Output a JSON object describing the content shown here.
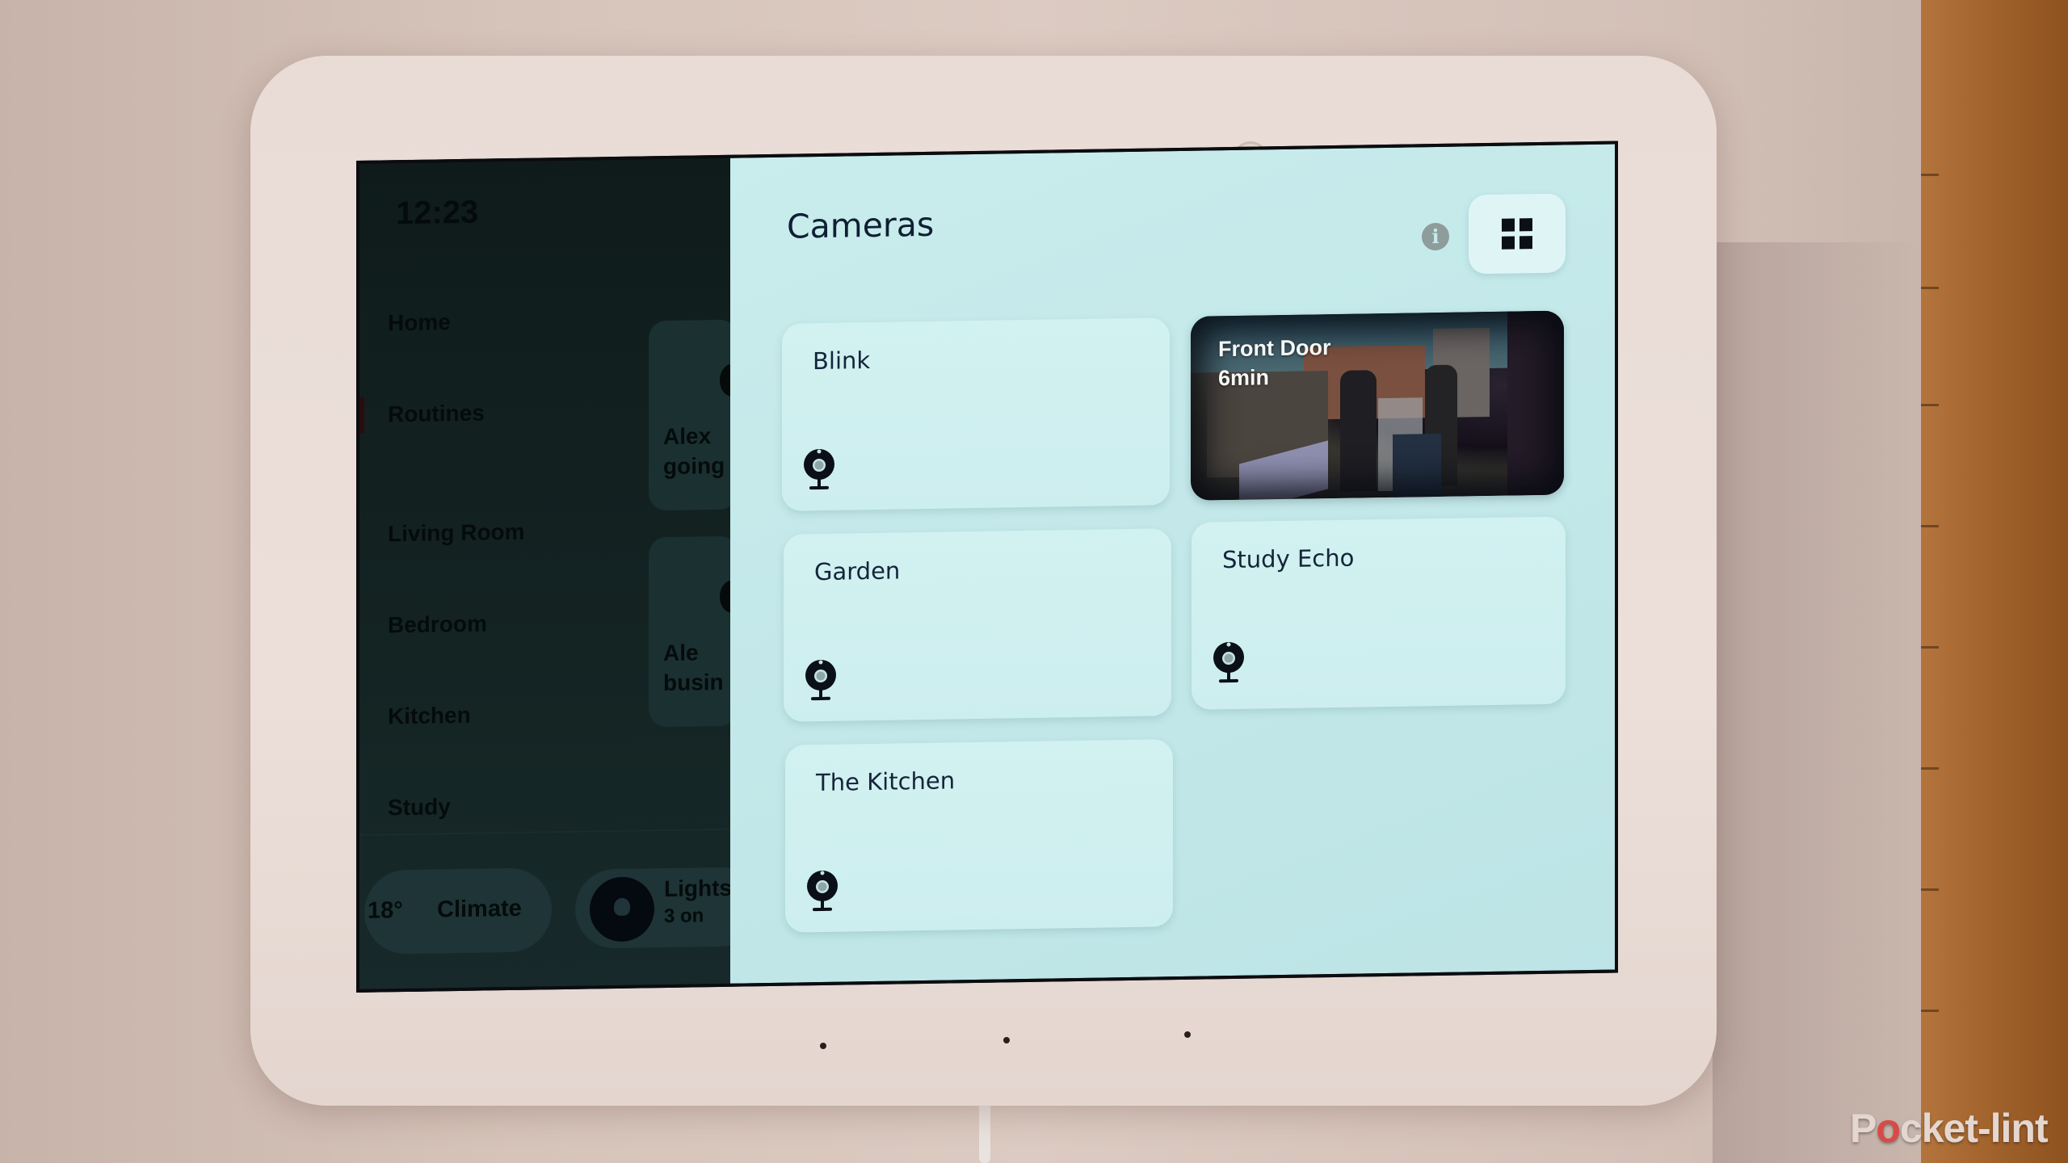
{
  "device": {
    "sidebar": {
      "clock": "12:23",
      "nav_items": [
        {
          "label": "Home"
        },
        {
          "label": "Routines",
          "active": true
        },
        {
          "label": "Living Room"
        },
        {
          "label": "Bedroom"
        },
        {
          "label": "Kitchen"
        },
        {
          "label": "Study"
        }
      ],
      "routine_cards": [
        {
          "line1": "Alex",
          "line2": "going"
        },
        {
          "line1": "Ale",
          "line2": "busin"
        }
      ],
      "climate": {
        "temperature": "18°",
        "label": "Climate"
      },
      "lights": {
        "label": "Lights",
        "status": "3 on"
      }
    },
    "cameras_panel": {
      "title": "Cameras",
      "info_icon": "info-icon",
      "view_toggle_icon": "grid-icon",
      "cameras": [
        {
          "name": "Blink",
          "icon": "webcam-icon"
        },
        {
          "name": "Front Door",
          "live_feed": true,
          "last_updated": "6min"
        },
        {
          "name": "Garden",
          "icon": "webcam-icon"
        },
        {
          "name": "Study Echo",
          "icon": "webcam-icon"
        },
        {
          "name": "The Kitchen",
          "icon": "webcam-icon"
        }
      ]
    }
  },
  "watermark": {
    "prefix": "P",
    "o": "o",
    "suffix": "cket-lint"
  },
  "colors": {
    "panel_bg": "#c6eaea",
    "card_bg": "#d0f0f0",
    "sidebar_bg": "#122120",
    "text_dark": "#14253a",
    "watermark_accent": "#d84a45"
  }
}
